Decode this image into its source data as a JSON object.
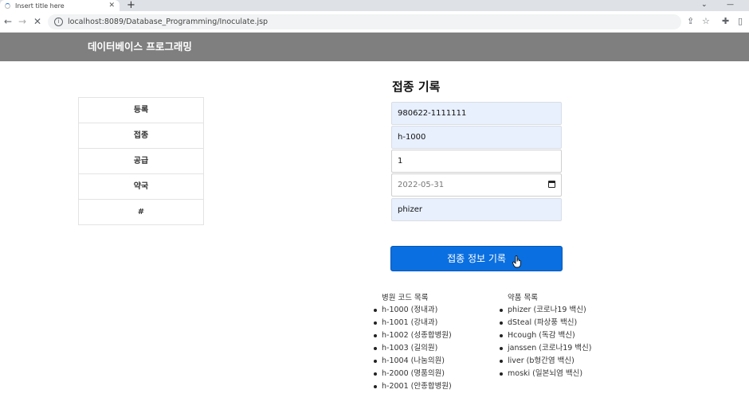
{
  "browser": {
    "tab_title": "Insert title here",
    "new_tab": "+",
    "url": "localhost:8089/Database_Programming/Inoculate.jsp"
  },
  "header": {
    "title": "데이터베이스 프로그래밍"
  },
  "sidebar": {
    "items": [
      {
        "label": "등록"
      },
      {
        "label": "접종"
      },
      {
        "label": "공급"
      },
      {
        "label": "약국"
      },
      {
        "label": "#"
      }
    ]
  },
  "form": {
    "title": "접종 기록",
    "fields": {
      "resident_id": "980622-1111111",
      "hospital_code": "h-1000",
      "dose": "1",
      "date": "2022-05-31",
      "vaccine": "phizer"
    },
    "submit_label": "접종 정보 기록"
  },
  "hospital_list": {
    "title": "병원 코드 목록",
    "items": [
      "h-1000 (정내과)",
      "h-1001 (강내과)",
      "h-1002 (성종합병원)",
      "h-1003 (길의원)",
      "h-1004 (나눔의원)",
      "h-2000 (명품의원)",
      "h-2001 (안종합병원)"
    ]
  },
  "vaccine_list": {
    "title": "약품 목록",
    "items": [
      "phizer (코로나19 백신)",
      "dSteal (파상풍 백신)",
      "Hcough (독감 백신)",
      "janssen (코로나19 백신)",
      "liver (b형간염 백신)",
      "moski (일본뇌염 백신)"
    ]
  }
}
